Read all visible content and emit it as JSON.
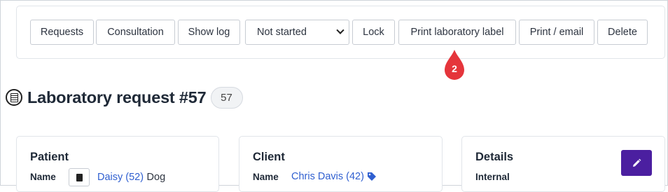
{
  "toolbar": {
    "buttons": {
      "requests": "Requests",
      "consultation": "Consultation",
      "show_log": "Show log",
      "lock": "Lock",
      "print_label": "Print laboratory label",
      "print_email": "Print / email",
      "delete": "Delete"
    },
    "status_select": {
      "value": "Not started"
    }
  },
  "marker": {
    "label": "2",
    "color": "#e5353b"
  },
  "page": {
    "title": "Laboratory request #57",
    "count_badge": "57"
  },
  "patient_card": {
    "title": "Patient",
    "name_label": "Name",
    "name_link": "Daisy (52)",
    "species": "Dog"
  },
  "client_card": {
    "title": "Client",
    "name_label": "Name",
    "name_link": "Chris Davis (42)"
  },
  "details_card": {
    "title": "Details",
    "internal_label": "Internal"
  },
  "colors": {
    "link": "#2f5fd0",
    "primary": "#4b1fa0",
    "marker": "#e5353b"
  }
}
